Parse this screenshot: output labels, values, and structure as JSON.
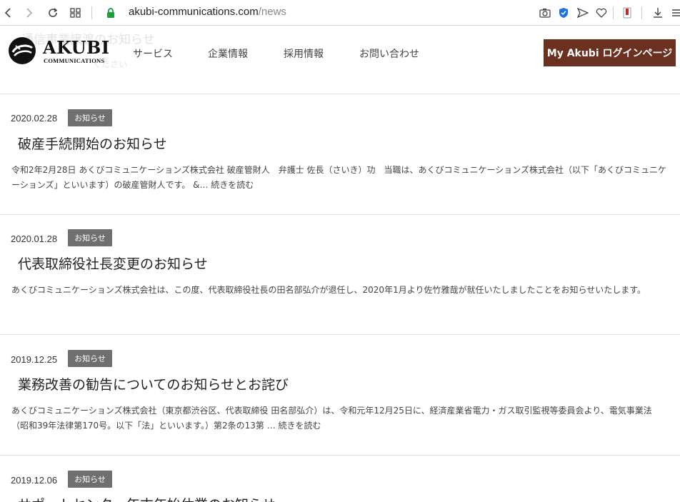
{
  "browser": {
    "url_domain": "akubi-communications.com",
    "url_path": "/news"
  },
  "header": {
    "ghost_title": "通信事業譲渡のお知らせ",
    "ghost_sub": "ください",
    "logo_name": "AKUBI",
    "logo_sub": "COMMUNICATIONS",
    "nav": [
      "サービス",
      "企業情報",
      "採用情報",
      "お問い合わせ"
    ],
    "login_label": "My Akubi ログインページ"
  },
  "news": [
    {
      "date": "2020.02.28",
      "badge": "お知らせ",
      "title": "破産手続開始のお知らせ",
      "excerpt": "令和2年2月28日 あくびコミュニケーションズ株式会社 破産管財人　弁護士 佐長（さいき）功　当職は、あくびコミュニケーションズ株式会社（以下「あくびコミュニケーションズ」といいます）の破産管財人です。 &… 続きを読む"
    },
    {
      "date": "2020.01.28",
      "badge": "お知らせ",
      "title": "代表取締役社長変更のお知らせ",
      "excerpt": "あくびコミュニケーションズ株式会社は、この度、代表取締役社長の田名部弘介が退任し、2020年1月より佐竹雅哉が就任いたしましたことをお知らせいたします。"
    },
    {
      "date": "2019.12.25",
      "badge": "お知らせ",
      "title": "業務改善の勧告についてのお知らせとお詫び",
      "excerpt": "あくびコミュニケーションズ株式会社（東京都渋谷区、代表取締役 田名部弘介）は、令和元年12月25日に、経済産業省電力・ガス取引監視等委員会より、電気事業法（昭和39年法律第170号。以下「法」といいます。）第2条の13第 … 続きを読む"
    },
    {
      "date": "2019.12.06",
      "badge": "お知らせ",
      "title": "サポートセンター年末年始休業のお知らせ",
      "excerpt": ""
    }
  ]
}
